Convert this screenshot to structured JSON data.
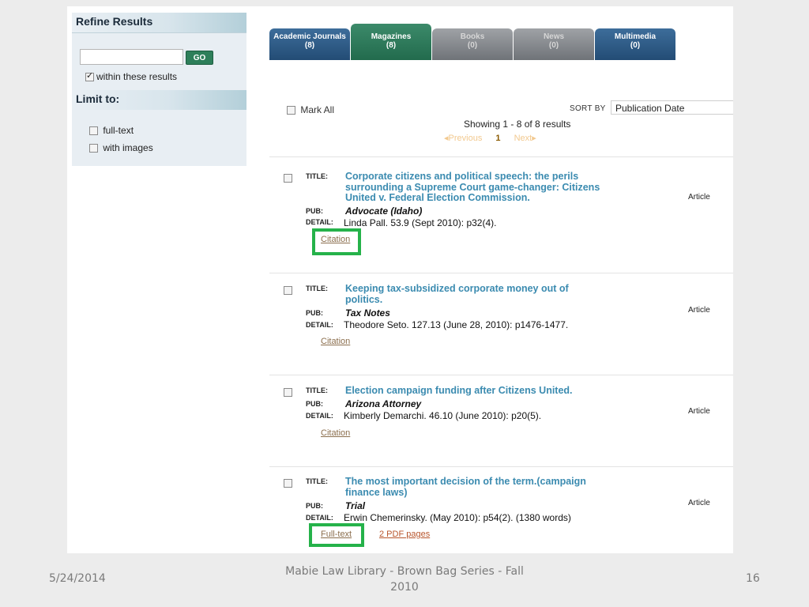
{
  "sidebar": {
    "refine_title": "Refine Results",
    "search_value": "",
    "go_label": "GO",
    "within_label": "within these results",
    "within_checked": true,
    "limit_title": "Limit to:",
    "limit_options": [
      {
        "label": "full-text",
        "checked": false
      },
      {
        "label": "with images",
        "checked": false
      }
    ]
  },
  "tabs": [
    {
      "label": "Academic Journals",
      "count": "(8)"
    },
    {
      "label": "Magazines",
      "count": "(8)"
    },
    {
      "label": "Books",
      "count": "(0)"
    },
    {
      "label": "News",
      "count": "(0)"
    },
    {
      "label": "Multimedia",
      "count": "(0)"
    }
  ],
  "toolbar": {
    "mark_all": "Mark All",
    "sort_by": "SORT BY",
    "sort_value": "Publication Date",
    "showing": "Showing 1 - 8 of 8 results",
    "prev": "Previous",
    "page": "1",
    "next": "Next"
  },
  "labels": {
    "title": "TITLE:",
    "pub": "PUB:",
    "detail": "DETAIL:"
  },
  "records": [
    {
      "title": "Corporate citizens and political speech: the perils surrounding a Supreme Court game-changer: Citizens United v. Federal Election Commission.",
      "pub": "Advocate (Idaho)",
      "detail": "Linda Pall. 53.9 (Sept 2010): p32(4).",
      "type": "Article",
      "links": [
        "Citation"
      ]
    },
    {
      "title": "Keeping tax-subsidized corporate money out of politics.",
      "pub": "Tax Notes",
      "detail": "Theodore Seto. 127.13 (June 28, 2010): p1476-1477.",
      "type": "Article",
      "links": [
        "Citation"
      ]
    },
    {
      "title": "Election campaign funding after Citizens United.",
      "pub": "Arizona Attorney",
      "detail": "Kimberly Demarchi. 46.10 (June 2010): p20(5).",
      "type": "Article",
      "links": [
        "Citation"
      ]
    },
    {
      "title": "The most important decision of the term.(campaign finance laws)",
      "pub": "Trial",
      "detail": "Erwin Chemerinsky. (May 2010): p54(2). (1380 words)",
      "type": "Article",
      "links": [
        "Full-text",
        "2 PDF pages"
      ]
    }
  ],
  "slide_footer": {
    "date": "5/24/2014",
    "center": "Mabie Law Library - Brown Bag Series - Fall 2010",
    "page_number": "16"
  },
  "colors": {
    "tab_active": "#2e7f5a",
    "tab_blue": "#2f5e8a",
    "title_link": "#3b8bb0",
    "highlight_box": "#25b24a"
  }
}
